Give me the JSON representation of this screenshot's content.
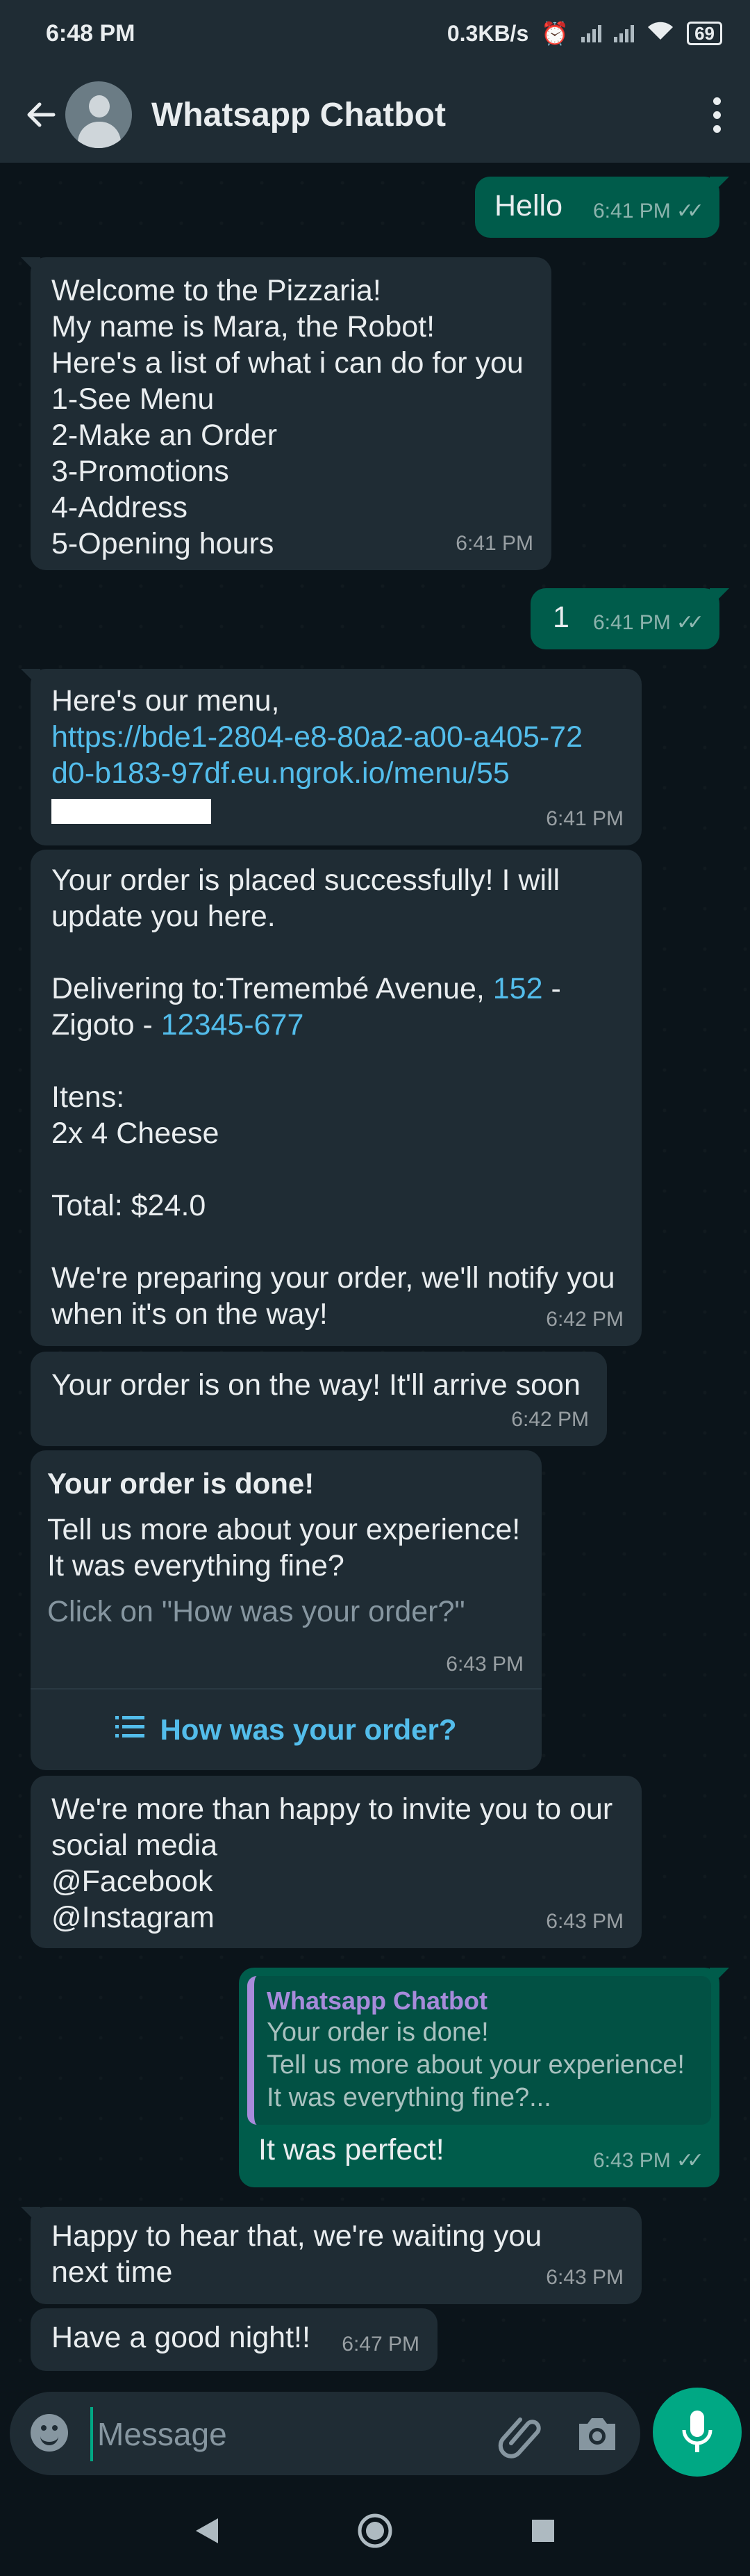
{
  "status": {
    "time": "6:48 PM",
    "speed": "0.3KB/s",
    "battery": "69"
  },
  "header": {
    "title": "Whatsapp Chatbot"
  },
  "messages": {
    "m1": {
      "text": "Hello",
      "time": "6:41 PM"
    },
    "m2": {
      "text": "Welcome to the Pizzaria!\nMy name is Mara, the Robot!\nHere's a list of what i can do for you\n1-See Menu\n2-Make an Order\n3-Promotions\n4-Address\n5-Opening hours",
      "time": "6:41 PM"
    },
    "m3": {
      "text": "1",
      "time": "6:41 PM"
    },
    "m4": {
      "text": "Here's our menu,",
      "link": "https://bde1-2804-e8-80a2-a00-a405-72d0-b183-97df.eu.ngrok.io/menu/55",
      "time": "6:41 PM"
    },
    "m5": {
      "p1": "Your order is placed successfully! I will update you here.",
      "delivering_prefix": "Delivering to:Tremembé Avenue, ",
      "number": "152",
      "sep1": " - Zigoto - ",
      "zip": "12345-677",
      "items_label": "Itens:",
      "item1": "2x 4 Cheese",
      "total": "Total: $24.0",
      "p_last": "We're preparing your order, we'll notify you when it's on the way!",
      "time": "6:42 PM"
    },
    "m6": {
      "text": "Your order is on the way! It'll arrive soon",
      "time": "6:42 PM"
    },
    "m7": {
      "header": "Your order is done!",
      "body": "Tell us more about your experience!\nIt was everything fine?",
      "footer": "Click on \"How was your order?\"",
      "time": "6:43 PM",
      "button": "How was your order?"
    },
    "m8": {
      "text": "We're more than happy to invite you to our social media\n@Facebook\n@Instagram",
      "time": "6:43 PM"
    },
    "m9": {
      "quote_author": "Whatsapp Chatbot",
      "quote_text": "Your order is done!\nTell us more about your experience!\nIt was everything fine?...",
      "text": "It was perfect!",
      "time": "6:43 PM"
    },
    "m10": {
      "text": "Happy to hear that, we're waiting you next time",
      "time": "6:43 PM"
    },
    "m11": {
      "text": "Have a good night!!",
      "time": "6:47 PM"
    }
  },
  "input": {
    "placeholder": "Message"
  },
  "colors": {
    "accent": "#00a884",
    "outgoing": "#005c4b",
    "incoming": "#1f2c34",
    "link": "#53bdeb",
    "background": "#0b141a"
  }
}
